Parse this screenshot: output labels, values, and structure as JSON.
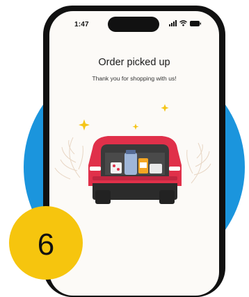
{
  "status_bar": {
    "time": "1:47"
  },
  "screen": {
    "title": "Order picked up",
    "subtitle": "Thank you for shopping with us!"
  },
  "step_badge": {
    "number": "6"
  },
  "colors": {
    "circle_bg": "#1b95dd",
    "badge_bg": "#f6c50e",
    "car_body": "#e0304a",
    "sparkle": "#f5c518"
  },
  "icons": [
    "signal-icon",
    "wifi-icon",
    "battery-icon",
    "car-illustration"
  ]
}
